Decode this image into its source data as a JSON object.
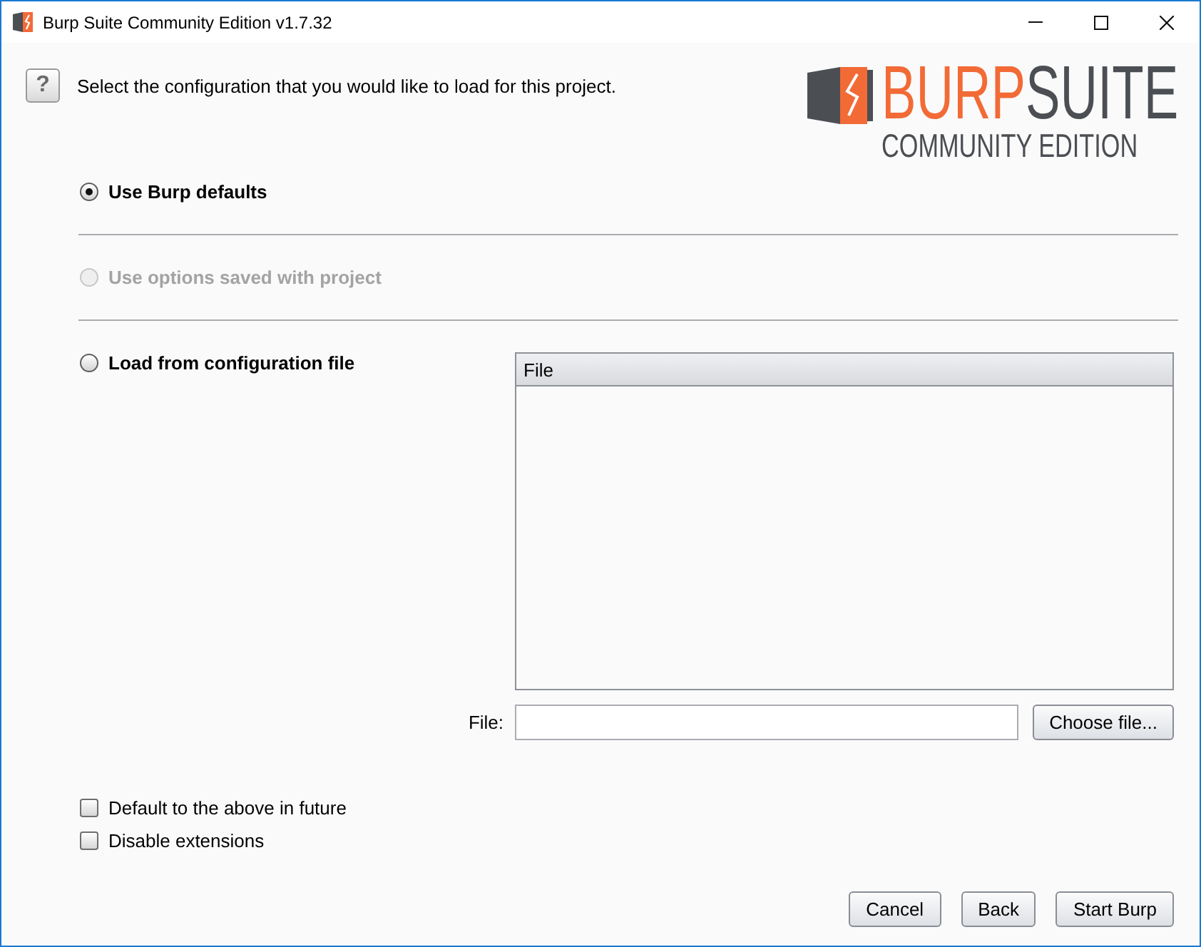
{
  "window": {
    "title": "Burp Suite Community Edition v1.7.32"
  },
  "header": {
    "help_button": "?",
    "prompt": "Select the configuration that you would like to load for this project.",
    "logo": {
      "wordmark": "BURPSUITE",
      "edition": "COMMUNITY EDITION"
    }
  },
  "options": [
    {
      "kind": "plain",
      "label": "Use Burp defaults",
      "selected": true,
      "disabled": false
    },
    {
      "kind": "plain",
      "label": "Use options saved with project",
      "selected": false,
      "disabled": true
    },
    {
      "kind": "file",
      "label": "Load from configuration file",
      "selected": false,
      "disabled": false,
      "table": {
        "columns": [
          "File"
        ]
      },
      "field": {
        "label": "File:",
        "button": "Choose file..."
      }
    }
  ],
  "checkboxes": [
    {
      "label": "Default to the above in future",
      "checked": false
    },
    {
      "label": "Disable extensions",
      "checked": false
    }
  ],
  "buttons": [
    "Cancel",
    "Back",
    "Start Burp"
  ]
}
